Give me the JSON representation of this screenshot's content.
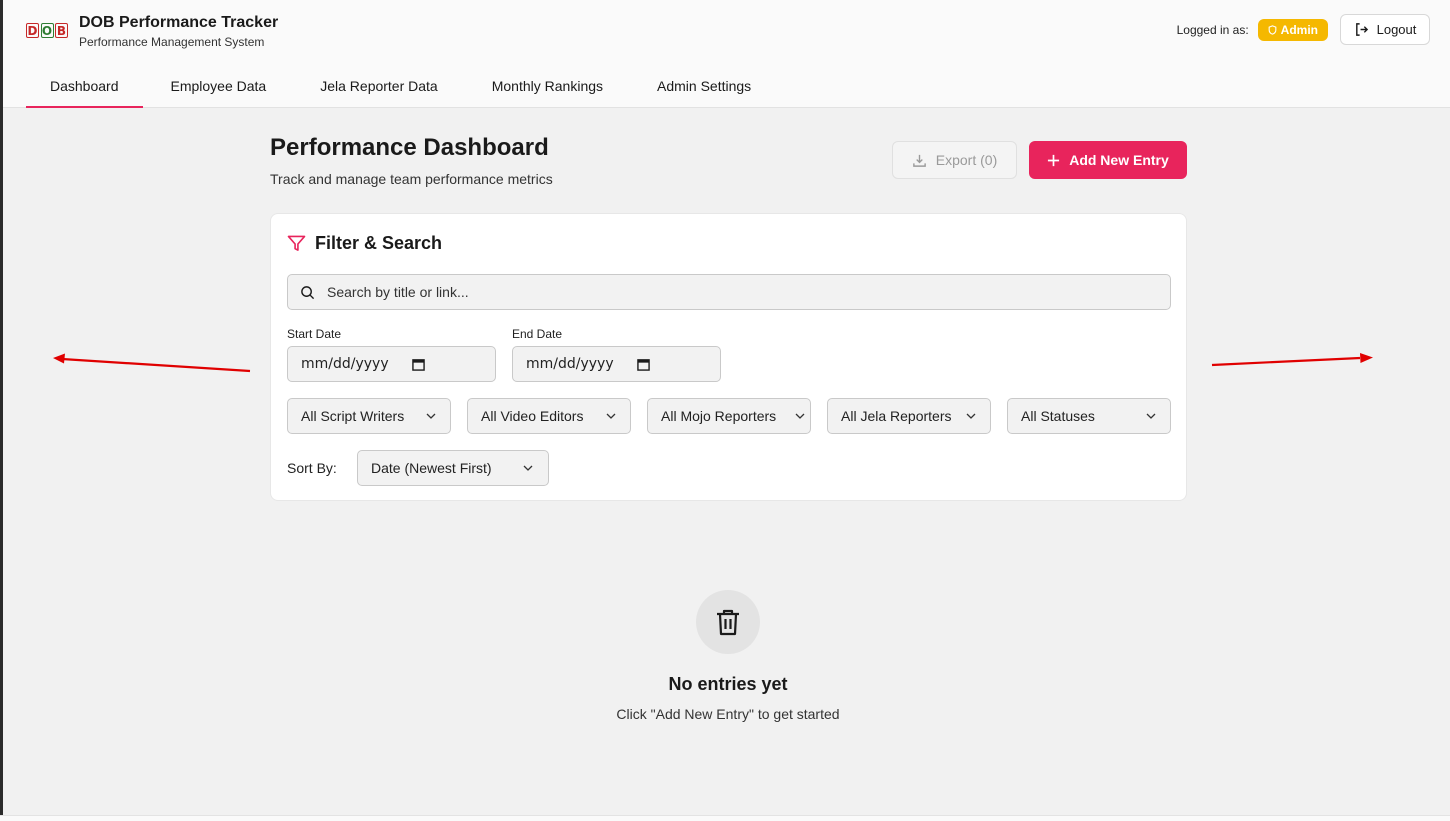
{
  "brand": {
    "logo_letters": [
      "D",
      "O",
      "B"
    ],
    "title": "DOB Performance Tracker",
    "subtitle": "Performance Management System"
  },
  "user": {
    "logged_in_label": "Logged in as:",
    "role": "Admin",
    "logout_label": "Logout"
  },
  "tabs": [
    {
      "label": "Dashboard",
      "active": true
    },
    {
      "label": "Employee Data",
      "active": false
    },
    {
      "label": "Jela Reporter Data",
      "active": false
    },
    {
      "label": "Monthly Rankings",
      "active": false
    },
    {
      "label": "Admin Settings",
      "active": false
    }
  ],
  "page": {
    "title": "Performance Dashboard",
    "subtitle": "Track and manage team performance metrics",
    "export_label": "Export (0)",
    "add_label": "Add New Entry"
  },
  "filters": {
    "title": "Filter & Search",
    "search_placeholder": "Search by title or link...",
    "start_date_label": "Start Date",
    "start_date_value": "mm/dd/yyyy",
    "end_date_label": "End Date",
    "end_date_value": "mm/dd/yyyy",
    "selects": [
      {
        "value": "All Script Writers"
      },
      {
        "value": "All Video Editors"
      },
      {
        "value": "All Mojo Reporters"
      },
      {
        "value": "All Jela Reporters"
      },
      {
        "value": "All Statuses"
      }
    ],
    "sort_label": "Sort By:",
    "sort_value": "Date (Newest First)"
  },
  "empty_state": {
    "icon": "trash-icon",
    "title": "No entries yet",
    "subtitle": "Click \"Add New Entry\" to get started"
  },
  "colors": {
    "accent": "#e8245c",
    "badge": "#f5b800",
    "background": "#f1f1f1",
    "annotation_arrow": "#e00000"
  }
}
